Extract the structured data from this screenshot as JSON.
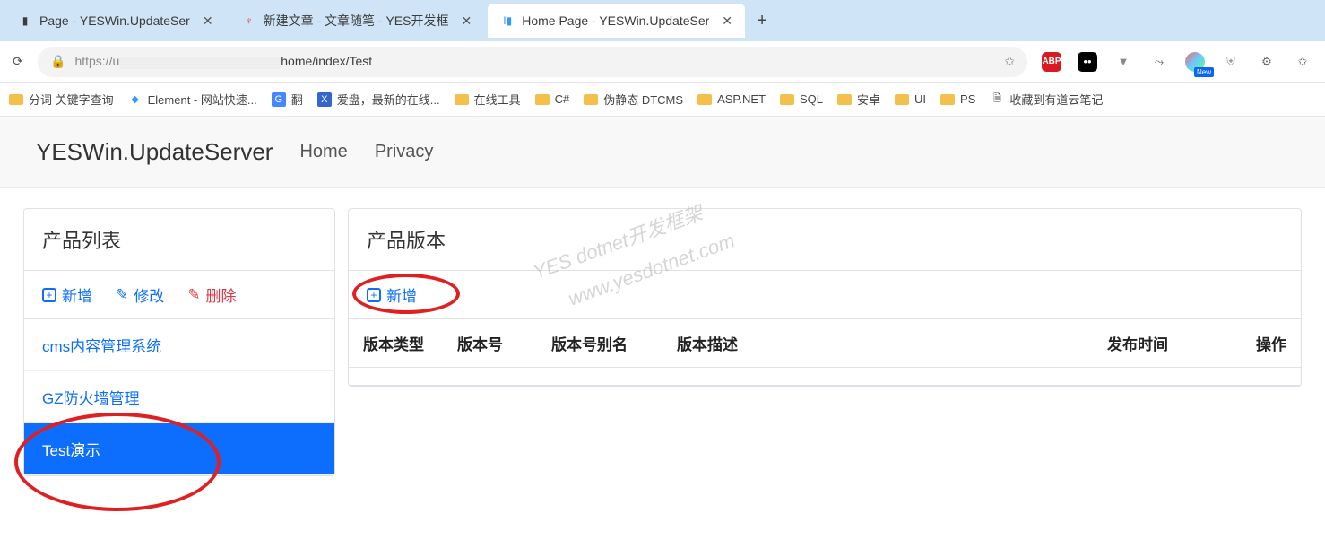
{
  "browser": {
    "tabs": [
      {
        "title": "Page - YESWin.UpdateSer",
        "favicon": "▮"
      },
      {
        "title": "新建文章 - 文章随笔 - YES开发框",
        "favicon": "Y",
        "favcolor": "#d43"
      },
      {
        "title": "Home Page - YESWin.UpdateSer",
        "favicon": "I",
        "favcolor": "#39f"
      }
    ],
    "url": {
      "prefix": "https://u",
      "suffix": "home/index/Test"
    },
    "bookmarks": [
      {
        "label": "分词 关键字查询",
        "icon": "folder"
      },
      {
        "label": "Element - 网站快速...",
        "icon": "E",
        "color": "#39f"
      },
      {
        "label": "翻",
        "icon": "G",
        "color": "#48f"
      },
      {
        "label": "爱盘，最新的在线...",
        "icon": "X",
        "color": "#36c"
      },
      {
        "label": "在线工具",
        "icon": "folder"
      },
      {
        "label": "C#",
        "icon": "folder"
      },
      {
        "label": "伪静态 DTCMS",
        "icon": "folder"
      },
      {
        "label": "ASP.NET",
        "icon": "folder"
      },
      {
        "label": "SQL",
        "icon": "folder"
      },
      {
        "label": "安卓",
        "icon": "folder"
      },
      {
        "label": "UI",
        "icon": "folder"
      },
      {
        "label": "PS",
        "icon": "folder"
      },
      {
        "label": "收藏到有道云笔记",
        "icon": "doc"
      }
    ],
    "ext_abp": "ABP",
    "ext_new": "New"
  },
  "nav": {
    "brand": "YESWin.UpdateServer",
    "home": "Home",
    "privacy": "Privacy"
  },
  "products": {
    "title": "产品列表",
    "add": "新增",
    "edit": "修改",
    "del": "删除",
    "items": [
      "cms内容管理系统",
      "GZ防火墙管理",
      "Test演示"
    ]
  },
  "versions": {
    "title": "产品版本",
    "add": "新增",
    "cols": [
      "版本类型",
      "版本号",
      "版本号别名",
      "版本描述",
      "发布时间",
      "操作"
    ]
  },
  "watermarks": {
    "a": "YES dotnet开发框架",
    "b": "www.yesdotnet.com"
  }
}
